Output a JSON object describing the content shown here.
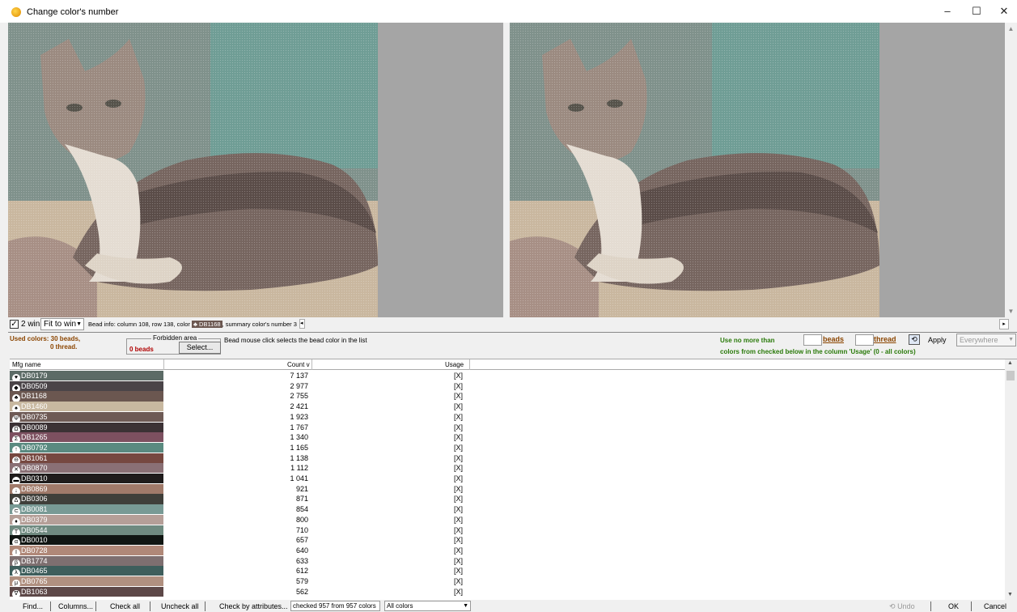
{
  "window": {
    "title": "Change color's number",
    "minimize": "–",
    "maximize": "☐",
    "close": "✕"
  },
  "info_bar": {
    "two_win_checked": "✓",
    "two_win_label": "2 win",
    "fit_option": "Fit to win",
    "bead_info_prefix": "Bead info: column 108, row 138, color",
    "bead_info_color": "♣ DB1168",
    "bead_info_suffix": ", summary color's number 3"
  },
  "controls": {
    "used_colors_line1": "Used colors: 30 beads,",
    "used_colors_line2": "0 thread.",
    "forbidden_caption": "Forbidden area",
    "forbidden_beads": "0 beads",
    "select_button": "Select...",
    "hint": "Bead mouse click selects the bead color in the list",
    "use_no_more": "Use no more than",
    "beads_label": "beads",
    "thread_label": "thread",
    "apply_label": "Apply",
    "scope": "Everywhere",
    "colors_from": "colors from checked below in the column 'Usage' (0 - all colors)"
  },
  "table": {
    "columns": [
      "Mfg name",
      "Count v",
      "Usage"
    ],
    "rows": [
      {
        "name": "DB0179",
        "count": "7 137",
        "usage": "[X]",
        "color": "#5c6b66",
        "sym": "♥"
      },
      {
        "name": "DB0509",
        "count": "2 977",
        "usage": "[X]",
        "color": "#4a4448",
        "sym": "◆"
      },
      {
        "name": "DB1168",
        "count": "2 755",
        "usage": "[X]",
        "color": "#6b5750",
        "sym": "♣"
      },
      {
        "name": "DB1460",
        "count": "2 421",
        "usage": "[X]",
        "color": "#c8b8a0",
        "sym": "♠"
      },
      {
        "name": "DB0735",
        "count": "1 923",
        "usage": "[X]",
        "color": "#6e5a55",
        "sym": "Ψ"
      },
      {
        "name": "DB0089",
        "count": "1 767",
        "usage": "[X]",
        "color": "#3c3235",
        "sym": "Ω"
      },
      {
        "name": "DB1265",
        "count": "1 340",
        "usage": "[X]",
        "color": "#7d5060",
        "sym": "Σ"
      },
      {
        "name": "DB0792",
        "count": "1 165",
        "usage": "[X]",
        "color": "#5a8a80",
        "sym": "↑"
      },
      {
        "name": "DB1061",
        "count": "1 138",
        "usage": "[X]",
        "color": "#764840",
        "sym": "⊖"
      },
      {
        "name": "DB0870",
        "count": "1 112",
        "usage": "[X]",
        "color": "#8a7075",
        "sym": "✕"
      },
      {
        "name": "DB0310",
        "count": "1 041",
        "usage": "[X]",
        "color": "#1f1c1c",
        "sym": "▬"
      },
      {
        "name": "DB0869",
        "count": "921",
        "usage": "[X]",
        "color": "#a07a6a",
        "sym": "↓"
      },
      {
        "name": "DB0306",
        "count": "871",
        "usage": "[X]",
        "color": "#3f3f3a",
        "sym": "Δ"
      },
      {
        "name": "DB0081",
        "count": "854",
        "usage": "[X]",
        "color": "#789a95",
        "sym": "⊂"
      },
      {
        "name": "DB0379",
        "count": "800",
        "usage": "[X]",
        "color": "#b59f98",
        "sym": "♦"
      },
      {
        "name": "DB0544",
        "count": "710",
        "usage": "[X]",
        "color": "#6f8a80",
        "sym": "T"
      },
      {
        "name": "DB0010",
        "count": "657",
        "usage": "[X]",
        "color": "#101512",
        "sym": "α"
      },
      {
        "name": "DB0728",
        "count": "640",
        "usage": "[X]",
        "color": "#b08878",
        "sym": "I"
      },
      {
        "name": "DB1774",
        "count": "633",
        "usage": "[X]",
        "color": "#7e6f70",
        "sym": "β"
      },
      {
        "name": "DB0465",
        "count": "612",
        "usage": "[X]",
        "color": "#3e5e5c",
        "sym": "λ"
      },
      {
        "name": "DB0765",
        "count": "579",
        "usage": "[X]",
        "color": "#b09080",
        "sym": "μ"
      },
      {
        "name": "DB1063",
        "count": "562",
        "usage": "[X]",
        "color": "#5d4848",
        "sym": "∇"
      }
    ]
  },
  "bottom": {
    "find": "Find...",
    "columns": "Columns...",
    "check_all": "Check all",
    "uncheck_all": "Uncheck all",
    "check_by_attr": "Check by attributes...",
    "status": "checked 957 from 957 colors",
    "filter": "All colors",
    "undo": "Undo",
    "ok": "OK",
    "cancel": "Cancel"
  }
}
